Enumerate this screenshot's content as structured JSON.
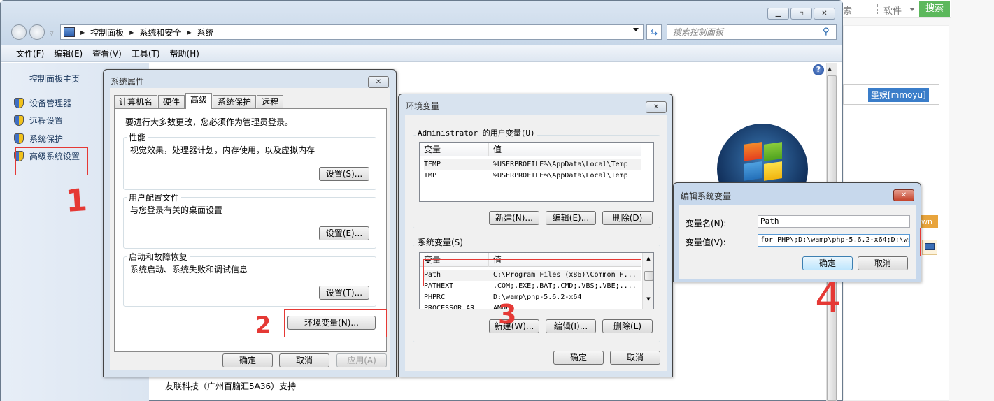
{
  "web_page": {
    "search_text": "索",
    "category": "软件",
    "search_button": "搜索",
    "username": "墨娱[mmoyu]",
    "orange_badge": "wn"
  },
  "explorer": {
    "breadcrumb": [
      "控制面板",
      "系统和安全",
      "系统"
    ],
    "search_placeholder": "搜索控制面板",
    "menu": [
      "文件(F)",
      "编辑(E)",
      "查看(V)",
      "工具(T)",
      "帮助(H)"
    ],
    "sidebar": {
      "home": "控制面板主页",
      "items": [
        "设备管理器",
        "远程设置",
        "系统保护",
        "高级系统设置"
      ]
    },
    "footer_text": "友联科技（广州百脑汇5A36）支持"
  },
  "system_properties": {
    "title": "系统属性",
    "tabs": [
      "计算机名",
      "硬件",
      "高级",
      "系统保护",
      "远程"
    ],
    "active_tab": "高级",
    "admin_note": "要进行大多数更改，您必须作为管理员登录。",
    "performance": {
      "label": "性能",
      "desc": "视觉效果，处理器计划，内存使用，以及虚拟内存",
      "button": "设置(S)..."
    },
    "user_profile": {
      "label": "用户配置文件",
      "desc": "与您登录有关的桌面设置",
      "button": "设置(E)..."
    },
    "startup": {
      "label": "启动和故障恢复",
      "desc": "系统启动、系统失败和调试信息",
      "button": "设置(T)..."
    },
    "env_button": "环境变量(N)...",
    "ok": "确定",
    "cancel": "取消",
    "apply": "应用(A)"
  },
  "env_vars": {
    "title": "环境变量",
    "user_group": "Administrator 的用户变量(U)",
    "columns": [
      "变量",
      "值"
    ],
    "user_vars": [
      {
        "name": "TEMP",
        "value": "%USERPROFILE%\\AppData\\Local\\Temp"
      },
      {
        "name": "TMP",
        "value": "%USERPROFILE%\\AppData\\Local\\Temp"
      }
    ],
    "user_buttons": [
      "新建(N)...",
      "编辑(E)...",
      "删除(D)"
    ],
    "system_group": "系统变量(S)",
    "system_vars": [
      {
        "name": "Path",
        "value": "C:\\Program Files (x86)\\Common F..."
      },
      {
        "name": "PATHEXT",
        "value": ".COM;.EXE;.BAT;.CMD;.VBS;.VBE;...."
      },
      {
        "name": "PHPRC",
        "value": "D:\\wamp\\php-5.6.2-x64"
      },
      {
        "name": "PROCESSOR_AR",
        "value": "AMD64"
      }
    ],
    "system_buttons": [
      "新建(W)...",
      "编辑(I)...",
      "删除(L)"
    ],
    "ok": "确定",
    "cancel": "取消"
  },
  "edit_var": {
    "title": "编辑系统变量",
    "name_label": "变量名(N):",
    "name_value": "Path",
    "value_label": "变量值(V):",
    "value_value": "for PHP\\;D:\\wamp\\php-5.6.2-x64;D:\\ws",
    "ok": "确定",
    "cancel": "取消"
  },
  "annotations": [
    "1",
    "2",
    "3",
    "4"
  ],
  "colors": {
    "annotation": "#e53935",
    "web_green": "#5cb85c",
    "web_blue": "#3a7dc9"
  }
}
